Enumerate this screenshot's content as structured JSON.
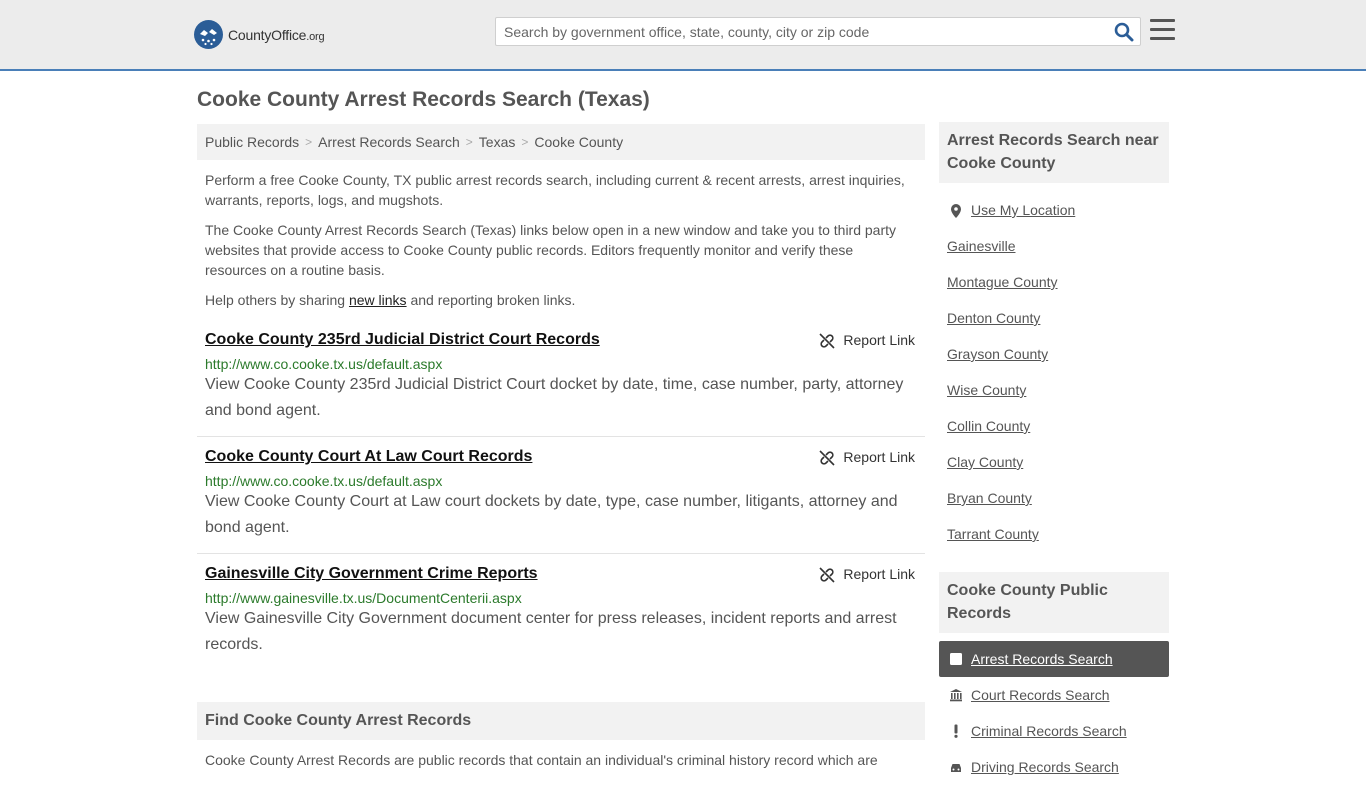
{
  "header": {
    "logo_text_main": "CountyOffice",
    "logo_text_suffix": ".org",
    "search_placeholder": "Search by government office, state, county, city or zip code"
  },
  "page": {
    "title": "Cooke County Arrest Records Search (Texas)",
    "breadcrumb": [
      "Public Records",
      "Arrest Records Search",
      "Texas",
      "Cooke County"
    ],
    "intro1": "Perform a free Cooke County, TX public arrest records search, including current & recent arrests, arrest inquiries, warrants, reports, logs, and mugshots.",
    "intro2": "The Cooke County Arrest Records Search (Texas) links below open in a new window and take you to third party websites that provide access to Cooke County public records. Editors frequently monitor and verify these resources on a routine basis.",
    "intro3_before": "Help others by sharing ",
    "intro3_link": "new links",
    "intro3_after": " and reporting broken links."
  },
  "results": [
    {
      "title": "Cooke County 235rd Judicial District Court Records",
      "url": "http://www.co.cooke.tx.us/default.aspx",
      "desc": "View Cooke County 235rd Judicial District Court docket by date, time, case number, party, attorney and bond agent.",
      "report": "Report Link"
    },
    {
      "title": "Cooke County Court At Law Court Records",
      "url": "http://www.co.cooke.tx.us/default.aspx",
      "desc": "View Cooke County Court at Law court dockets by date, type, case number, litigants, attorney and bond agent.",
      "report": "Report Link"
    },
    {
      "title": "Gainesville City Government Crime Reports",
      "url": "http://www.gainesville.tx.us/DocumentCenterii.aspx",
      "desc": "View Gainesville City Government document center for press releases, incident reports and arrest records.",
      "report": "Report Link"
    }
  ],
  "find": {
    "heading": "Find Cooke County Arrest Records",
    "text": "Cooke County Arrest Records are public records that contain an individual's criminal history record which are"
  },
  "sidebar": {
    "near_heading": "Arrest Records Search near Cooke County",
    "use_location": "Use My Location",
    "near_links": [
      "Gainesville",
      "Montague County",
      "Denton County",
      "Grayson County",
      "Wise County",
      "Collin County",
      "Clay County",
      "Bryan County",
      "Tarrant County"
    ],
    "public_heading": "Cooke County Public Records",
    "public_links": [
      {
        "label": "Arrest Records Search",
        "icon": "square-icon",
        "active": true
      },
      {
        "label": "Court Records Search",
        "icon": "courthouse-icon",
        "active": false
      },
      {
        "label": "Criminal Records Search",
        "icon": "exclamation-icon",
        "active": false
      },
      {
        "label": "Driving Records Search",
        "icon": "car-icon",
        "active": false
      }
    ]
  },
  "colors": {
    "header_bg": "#ececec",
    "header_border": "#4a7fb8",
    "url_green": "#2b7a2b",
    "active_bg": "#555555"
  }
}
